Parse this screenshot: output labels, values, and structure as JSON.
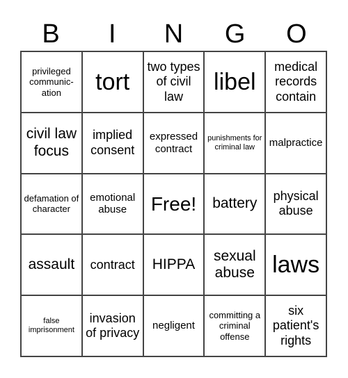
{
  "header": [
    "B",
    "I",
    "N",
    "G",
    "O"
  ],
  "cells": [
    "privileged communic-ation",
    "tort",
    "two types of civil law",
    "libel",
    "medical records contain",
    "civil law focus",
    "implied consent",
    "expressed contract",
    "punishments for criminal law",
    "malpractice",
    "defamation of character",
    "emotional abuse",
    "Free!",
    "battery",
    "physical abuse",
    "assault",
    "contract",
    "HIPPA",
    "sexual abuse",
    "laws",
    "false imprisonment",
    "invasion of privacy",
    "negligent",
    "committing a criminal offense",
    "six patient's rights"
  ]
}
